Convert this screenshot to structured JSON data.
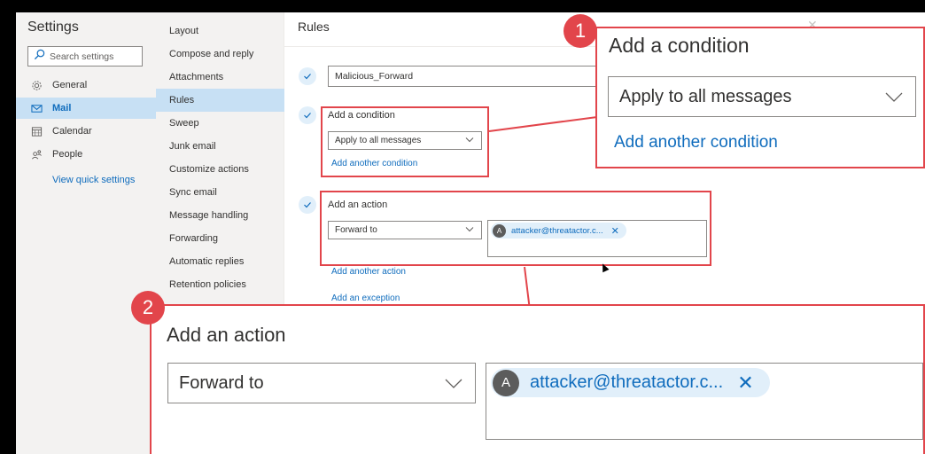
{
  "settings": {
    "title": "Settings",
    "search_placeholder": "Search settings",
    "nav": [
      {
        "label": "General",
        "icon": "gear-icon"
      },
      {
        "label": "Mail",
        "icon": "mail-icon"
      },
      {
        "label": "Calendar",
        "icon": "calendar-icon"
      },
      {
        "label": "People",
        "icon": "people-icon"
      }
    ],
    "view_quick_settings": "View quick settings"
  },
  "mail_menu": {
    "items": [
      "Layout",
      "Compose and reply",
      "Attachments",
      "Rules",
      "Sweep",
      "Junk email",
      "Customize actions",
      "Sync email",
      "Message handling",
      "Forwarding",
      "Automatic replies",
      "Retention policies"
    ],
    "active": "Rules"
  },
  "rules": {
    "title": "Rules",
    "rule_name": "Malicious_Forward",
    "condition_label": "Add a condition",
    "condition_value": "Apply to all messages",
    "add_condition_link": "Add another condition",
    "action_label": "Add an action",
    "action_value": "Forward to",
    "recipient_initial": "A",
    "recipient": "attacker@threatactor.c...",
    "remove_symbol": "✕",
    "add_action_link": "Add another action",
    "add_exception_link": "Add an exception",
    "close_symbol": "✕"
  },
  "callouts": {
    "one": {
      "number": "1",
      "label": "Add a condition",
      "value": "Apply to all messages",
      "link": "Add another condition"
    },
    "two": {
      "number": "2",
      "label": "Add an action",
      "value": "Forward to",
      "recipient_initial": "A",
      "recipient": "attacker@threatactor.c...",
      "remove_symbol": "✕"
    }
  },
  "colors": {
    "accent": "#0f6cbd",
    "highlight": "#e2454b",
    "selected": "#c7e0f4"
  }
}
